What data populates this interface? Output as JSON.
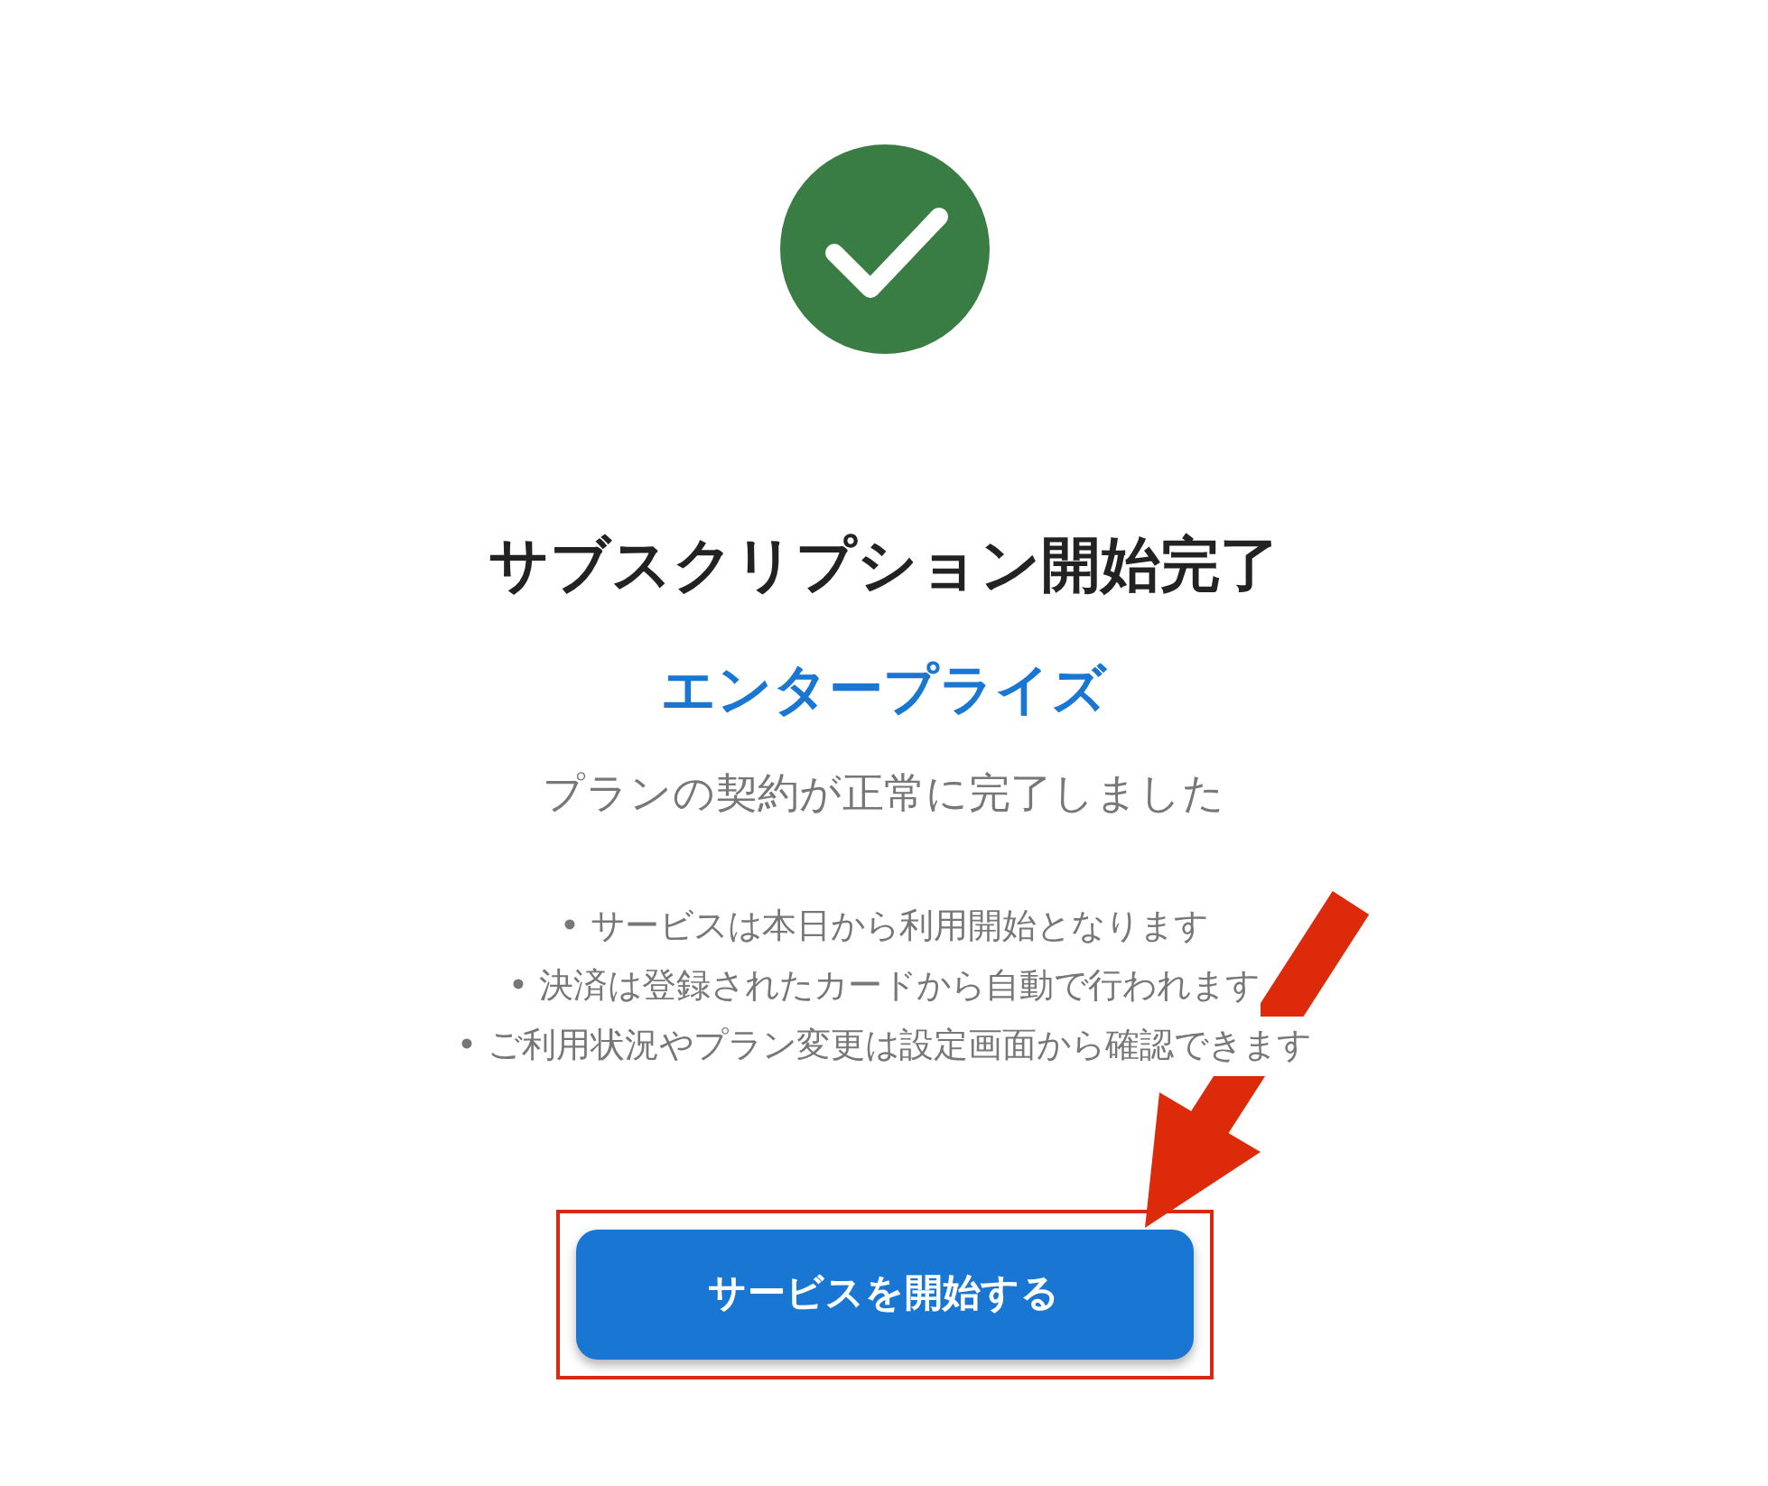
{
  "status_icon": {
    "kind": "success"
  },
  "title": "サブスクリプション開始完了",
  "plan": "エンタープライズ",
  "message": "プランの契約が正常に完了しました",
  "notes": [
    "• サービスは本日から利用開始となります",
    "• 決済は登録されたカードから自動で行われます",
    "• ご利用状況やプラン変更は設定画面から確認できます"
  ],
  "button": {
    "label": "サービスを開始する"
  }
}
